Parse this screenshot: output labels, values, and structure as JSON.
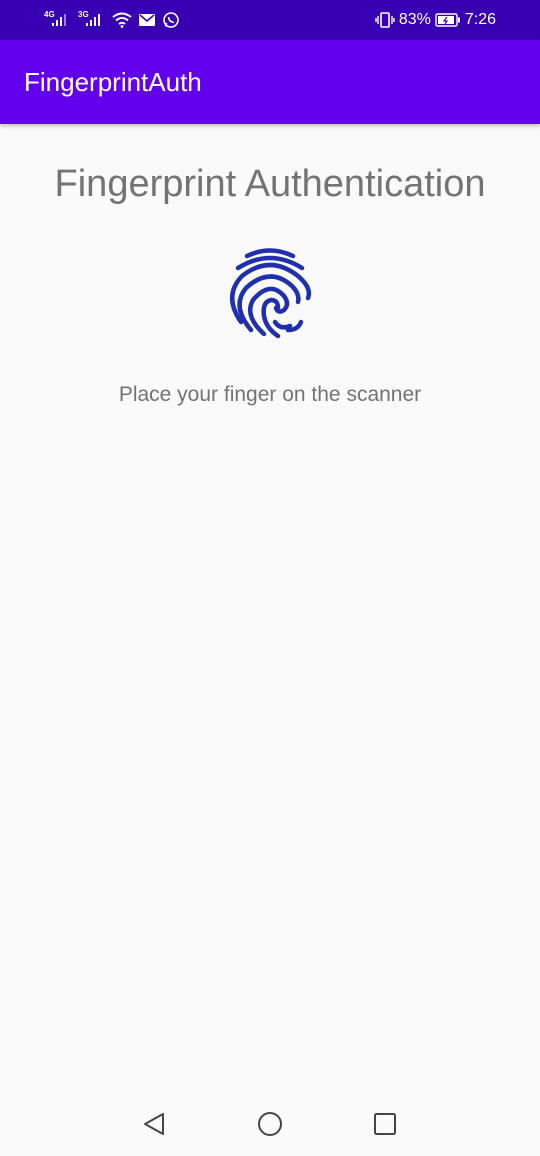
{
  "status_bar": {
    "network_1": "4G",
    "network_2": "3G",
    "battery": "83%",
    "time": "7:26",
    "icons": [
      "signal-icon",
      "signal-icon",
      "wifi-icon",
      "mail-icon",
      "whatsapp-icon",
      "vibrate-icon",
      "battery-icon"
    ]
  },
  "app_bar": {
    "title": "FingerprintAuth"
  },
  "main": {
    "title": "Fingerprint Authentication",
    "instruction": "Place your finger on the scanner",
    "icon": "fingerprint-icon"
  },
  "nav_bar": {
    "icons": [
      "back-icon",
      "home-icon",
      "recents-icon"
    ]
  },
  "colors": {
    "status_bar": "#3700b3",
    "app_bar": "#6200ee",
    "fingerprint": "#1f2fae",
    "text_gray": "#737373",
    "background": "#fafafa"
  }
}
